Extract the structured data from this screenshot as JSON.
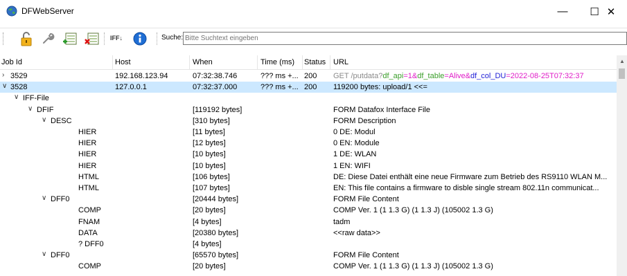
{
  "window": {
    "title": "DFWebServer",
    "minimize_glyph": "—",
    "maximize_glyph": "☐",
    "close_glyph": "✕"
  },
  "toolbar": {
    "icons": [
      "lock-open-icon",
      "wrench-icon",
      "add-list-icon",
      "delete-list-icon",
      "info-icon"
    ],
    "iff_label": "IFF↓",
    "search_label": "Suche:",
    "search_placeholder": "Bitte Suchtext eingeben"
  },
  "columns": {
    "job_id": "Job Id",
    "host": "Host",
    "when": "When",
    "time": "Time (ms)",
    "status": "Status",
    "url": "URL"
  },
  "colors": {
    "selection": "#cce8ff",
    "url_base": "#8a8a8a",
    "param_name": "#3a9e2a",
    "param_value": "#e01cc8",
    "param_name_alt": "#1c1cd6"
  },
  "rows": [
    {
      "expander": "›",
      "job_id": "3529",
      "host": "192.168.123.94",
      "when": "07:32:38.746",
      "time": "??? ms +...",
      "status": "200",
      "url_parts": [
        {
          "text": "GET /putdata?",
          "style": "base"
        },
        {
          "text": "df_api",
          "style": "name"
        },
        {
          "text": "=1&",
          "style": "value"
        },
        {
          "text": "df_table",
          "style": "name"
        },
        {
          "text": "=Alive&",
          "style": "value"
        },
        {
          "text": "df_col_DU",
          "style": "name_alt"
        },
        {
          "text": "=2022-08-25T07:32:37",
          "style": "value"
        }
      ]
    },
    {
      "expander": "∨",
      "job_id": "3528",
      "host": "127.0.0.1",
      "when": "07:32:37.000",
      "time": "??? ms +...",
      "status": "200",
      "url": "119200 bytes: upload/1 <<=",
      "selected": true
    },
    {
      "indent": 1,
      "expander": "∨",
      "name": "IFF-File",
      "size": "",
      "desc": ""
    },
    {
      "indent": 2,
      "expander": "∨",
      "name": "DFIF",
      "size": "[119192 bytes]",
      "desc": "FORM Datafox Interface File"
    },
    {
      "indent": 3,
      "expander": "∨",
      "name": "DESC",
      "size": "[310 bytes]",
      "desc": "FORM Description"
    },
    {
      "indent": 4,
      "name": "HIER",
      "size": "[11 bytes]",
      "desc": "0 DE: Modul"
    },
    {
      "indent": 4,
      "name": "HIER",
      "size": "[12 bytes]",
      "desc": "0 EN: Module"
    },
    {
      "indent": 4,
      "name": "HIER",
      "size": "[10 bytes]",
      "desc": "1 DE: WLAN"
    },
    {
      "indent": 4,
      "name": "HIER",
      "size": "[10 bytes]",
      "desc": "1 EN: WIFI"
    },
    {
      "indent": 4,
      "name": "HTML",
      "size": "[106 bytes]",
      "desc": "DE: Diese Datei enthält eine neue Firmware zum Betrieb des RS9110 WLAN M..."
    },
    {
      "indent": 4,
      "name": "HTML",
      "size": "[107 bytes]",
      "desc": "EN: This file contains a firmware to disble single stream 802.11n communicat..."
    },
    {
      "indent": 3,
      "expander": "∨",
      "name": "DFF0",
      "size": "[20444 bytes]",
      "desc": "FORM File Content"
    },
    {
      "indent": 4,
      "name": "COMP",
      "size": "[20 bytes]",
      "desc": "COMP Ver. 1 (1 1.3 G) (1 1.3 J) (105002 1.3 G)"
    },
    {
      "indent": 4,
      "name": "FNAM",
      "size": "[4 bytes]",
      "desc": "tadm"
    },
    {
      "indent": 4,
      "name": "DATA",
      "size": "[20380 bytes]",
      "desc": "<<raw data>>"
    },
    {
      "indent": 4,
      "name": "? DFF0",
      "size": "[4 bytes]",
      "desc": ""
    },
    {
      "indent": 3,
      "expander": "∨",
      "name": "DFF0",
      "size": "[65570 bytes]",
      "desc": "FORM File Content"
    },
    {
      "indent": 4,
      "name": "COMP",
      "size": "[20 bytes]",
      "desc": "COMP Ver. 1 (1 1.3 G) (1 1.3 J) (105002 1.3 G)"
    }
  ]
}
